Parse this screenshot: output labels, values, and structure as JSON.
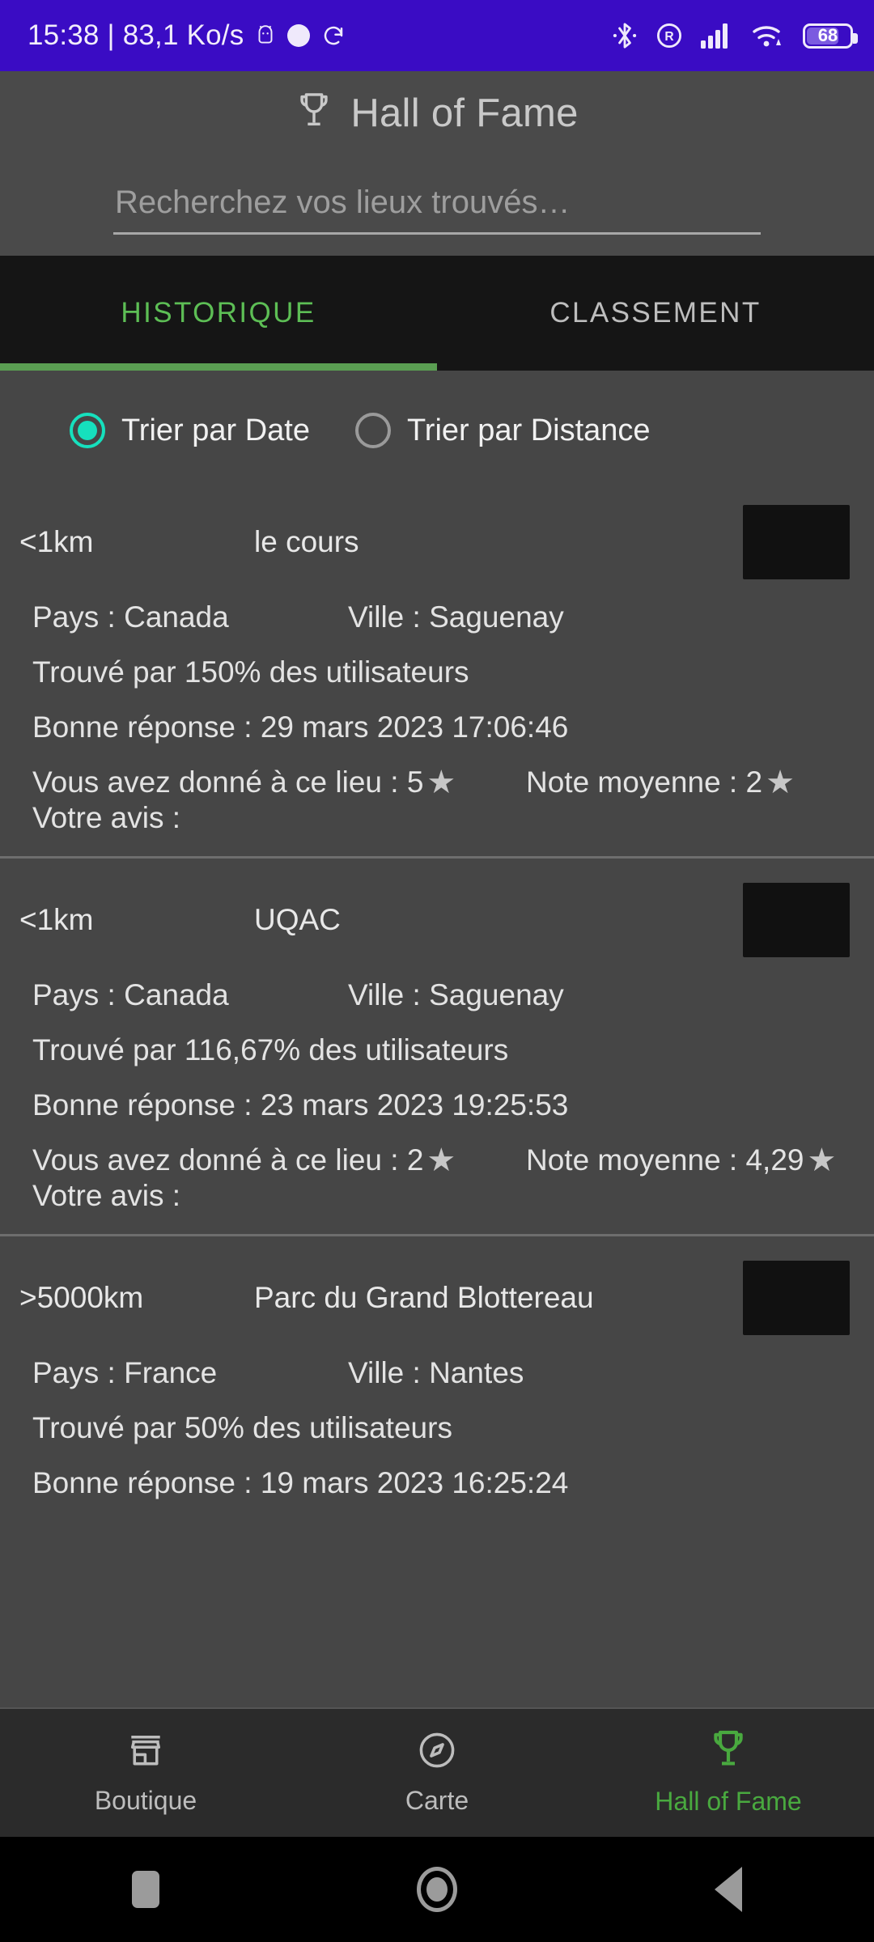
{
  "status_bar": {
    "clock": "15:38 | 83,1 Ko/s",
    "battery_percent": "68",
    "icons": [
      "android-head-icon",
      "white-circle-icon",
      "sync-icon",
      "bluetooth-icon",
      "roaming-r-icon",
      "signal-bars-icon",
      "wifi-icon",
      "battery-icon"
    ],
    "background_color": "#3A0CC4"
  },
  "app_bar": {
    "icon": "trophy-icon",
    "title": "Hall of Fame"
  },
  "search": {
    "placeholder": "Recherchez vos lieux trouvés…",
    "value": ""
  },
  "tabs": [
    {
      "label": "HISTORIQUE",
      "active": true,
      "color": "#5DBE55"
    },
    {
      "label": "CLASSEMENT",
      "active": false,
      "color": "#BDBDBD"
    }
  ],
  "sort": {
    "options": [
      {
        "label": "Trier par Date",
        "selected": true
      },
      {
        "label": "Trier par Distance",
        "selected": false
      }
    ],
    "accent_color": "#16E0BD"
  },
  "labels": {
    "pays": "Pays :",
    "ville": "Ville :",
    "avis": "Votre avis :",
    "star": "★"
  },
  "places": [
    {
      "distance": "<1km",
      "name": "le cours",
      "pays": "Pays : Canada",
      "ville": "Ville : Saguenay",
      "found_by": "Trouvé par 150% des utilisateurs",
      "bonne_reponse": "Bonne réponse : 29 mars 2023 17:06:46",
      "your_rating": "Vous avez donné à ce lieu : 5",
      "avg_rating": "Note moyenne : 2",
      "avis": "Votre avis :",
      "thumb": "calculator-screenshot-thumbnail"
    },
    {
      "distance": "<1km",
      "name": "UQAC",
      "pays": "Pays : Canada",
      "ville": "Ville : Saguenay",
      "found_by": "Trouvé par 116,67% des utilisateurs",
      "bonne_reponse": "Bonne réponse : 23 mars 2023 19:25:53",
      "your_rating": "Vous avez donné à ce lieu : 2",
      "avg_rating": "Note moyenne : 4,29",
      "avis": "Votre avis :",
      "thumb": "uqac-campus-aerial-thumbnail"
    },
    {
      "distance": ">5000km",
      "name": "Parc du Grand Blottereau",
      "pays": "Pays : France",
      "ville": "Ville : Nantes",
      "found_by": "Trouvé par 50% des utilisateurs",
      "bonne_reponse": "Bonne réponse : 19 mars 2023 16:25:24",
      "your_rating": "",
      "avg_rating": "",
      "avis": "",
      "thumb": "park-pond-autumn-thumbnail"
    }
  ],
  "bottom_nav": [
    {
      "label": "Boutique",
      "icon": "store-icon",
      "active": false
    },
    {
      "label": "Carte",
      "icon": "compass-icon",
      "active": false
    },
    {
      "label": "Hall of Fame",
      "icon": "trophy-icon",
      "active": true
    }
  ],
  "system_nav": {
    "recents": "square-recents-icon",
    "home": "circle-home-icon",
    "back": "triangle-back-icon"
  }
}
